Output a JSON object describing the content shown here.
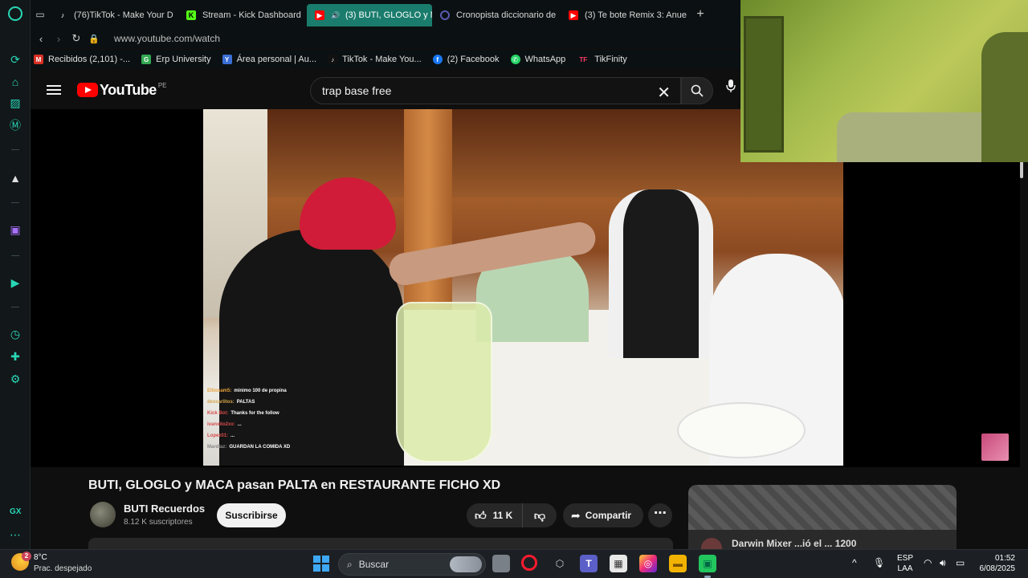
{
  "browser": {
    "tabs": [
      {
        "label": "(76)TikTok - Make Your D",
        "icon": "tiktok-icon",
        "color": "#000000"
      },
      {
        "label": "Stream - Kick Dashboard",
        "icon": "kick-icon",
        "color": "#53fc18"
      },
      {
        "label": "(3) BUTI, GLOGLO y M",
        "icon": "youtube-icon",
        "color": "#ff0000",
        "active": true
      },
      {
        "label": "Cronopista diccionario de",
        "icon": "cronopista-icon",
        "color": "#3c3c70"
      },
      {
        "label": "(3) Te bote Remix 3: Anue",
        "icon": "youtube-icon",
        "color": "#ff0000"
      }
    ],
    "new_tab": "+",
    "url": "www.youtube.com/watch",
    "bookmarks": [
      {
        "label": "Recibidos (2,101) -...",
        "icon": "gmail-icon",
        "glyph": "M",
        "color": "#d93025"
      },
      {
        "label": "Erp University",
        "icon": "erp-icon",
        "glyph": "G",
        "color": "#34a853"
      },
      {
        "label": "Área personal | Au...",
        "icon": "aula-icon",
        "glyph": "Y",
        "color": "#3b6fd6"
      },
      {
        "label": "TikTok - Make You...",
        "icon": "tiktok-icon",
        "glyph": "♪",
        "color": "#111111"
      },
      {
        "label": "(2) Facebook",
        "icon": "facebook-icon",
        "glyph": "f",
        "color": "#1877f2"
      },
      {
        "label": "WhatsApp",
        "icon": "whatsapp-icon",
        "glyph": "✆",
        "color": "#25d366"
      },
      {
        "label": "TikFinity",
        "icon": "tikfinity-icon",
        "glyph": "TF",
        "color": "#ff3b6b"
      }
    ],
    "sidebar_label": "GX"
  },
  "youtube": {
    "logo_text": "YouTube",
    "country": "PE",
    "search_value": "trap base free",
    "video_title": "BUTI, GLOGLO y MACA pasan PALTA en RESTAURANTE FICHO XD",
    "channel_name": "BUTI Recuerdos",
    "subscribers": "8.12 K suscriptores",
    "subscribe_label": "Suscribirse",
    "likes": "11 K",
    "share_label": "Compartir",
    "chat": [
      {
        "user": "Eltiosam5:",
        "text": "minimo 100 de propina",
        "color": "#e8a33c"
      },
      {
        "user": "dexcarlitos:",
        "text": "PALTAS",
        "color": "#d4a64a"
      },
      {
        "user": "Kick Bot:",
        "text": "Thanks for the follow",
        "color": "#d84a4a"
      },
      {
        "user": "ivanxito2xx:",
        "text": "...",
        "color": "#d84a4a"
      },
      {
        "user": "Lopez01:",
        "text": "...",
        "color": "#d84a4a"
      },
      {
        "user": "Mardiaz:",
        "text": "GUARDAN LA COMIDA XD",
        "color": "#888888"
      }
    ],
    "side_card_text": "Darwin Mixer ...ió el ... 1200"
  },
  "taskbar": {
    "temperature": "8°C",
    "condition": "Prac. despejado",
    "weather_badge": "2",
    "search_label": "Buscar",
    "language_top": "ESP",
    "language_bottom": "LAA",
    "time": "01:52",
    "date": "6/08/2025"
  }
}
